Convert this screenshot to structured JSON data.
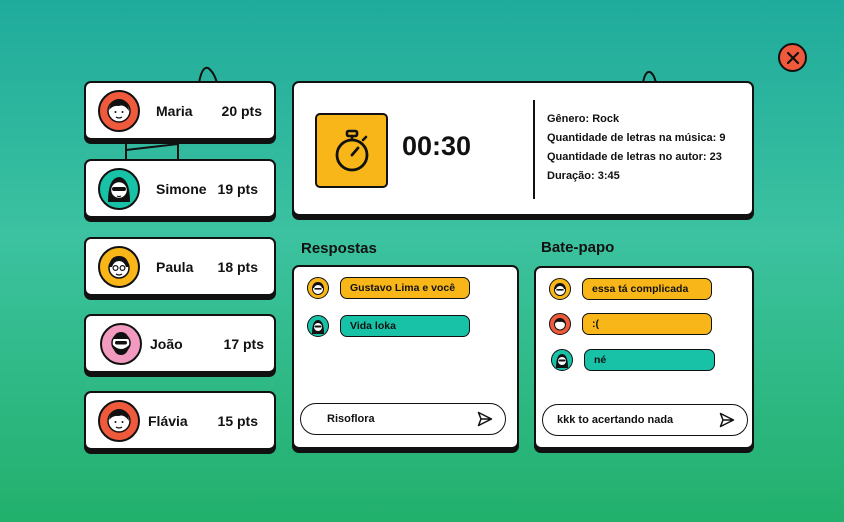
{
  "players": [
    {
      "name": "Maria",
      "points": "20 pts",
      "avatar_bg": "#f05a3c",
      "icon": "woman-avatar-icon"
    },
    {
      "name": "Simone",
      "points": "19 pts",
      "avatar_bg": "#17c2a6",
      "icon": "woman-sunglasses-avatar-icon"
    },
    {
      "name": "Paula",
      "points": "18 pts",
      "avatar_bg": "#f8b619",
      "icon": "woman-glasses-avatar-icon"
    },
    {
      "name": "João",
      "points": "17 pts",
      "avatar_bg": "#f39ac0",
      "icon": "man-beard-avatar-icon"
    },
    {
      "name": "Flávia",
      "points": "15 pts",
      "avatar_bg": "#f05a3c",
      "icon": "woman-avatar-icon"
    }
  ],
  "round": {
    "timer": "00:30",
    "info": [
      "Gênero: Rock",
      "Quantidade de letras na música: 9",
      "Quantidade de letras no autor: 23",
      "Duração: 3:45"
    ]
  },
  "answers": {
    "title": "Respostas",
    "messages": [
      {
        "text": "Gustavo Lima e você",
        "color": "#f8b619"
      },
      {
        "text": "Vida loka",
        "color": "#17c2a6"
      }
    ],
    "input_value": "Risoflora"
  },
  "chat": {
    "title": "Bate-papo",
    "messages": [
      {
        "text": "essa tá complicada",
        "color": "#f8b619"
      },
      {
        "text": ":(",
        "color": "#f8b619"
      },
      {
        "text": "né",
        "color": "#17c2a6"
      }
    ],
    "input_value": "kkk to acertando nada"
  },
  "colors": {
    "yellow": "#f8b619",
    "teal": "#17c2a6",
    "red": "#f05a3c",
    "pink": "#f39ac0"
  }
}
